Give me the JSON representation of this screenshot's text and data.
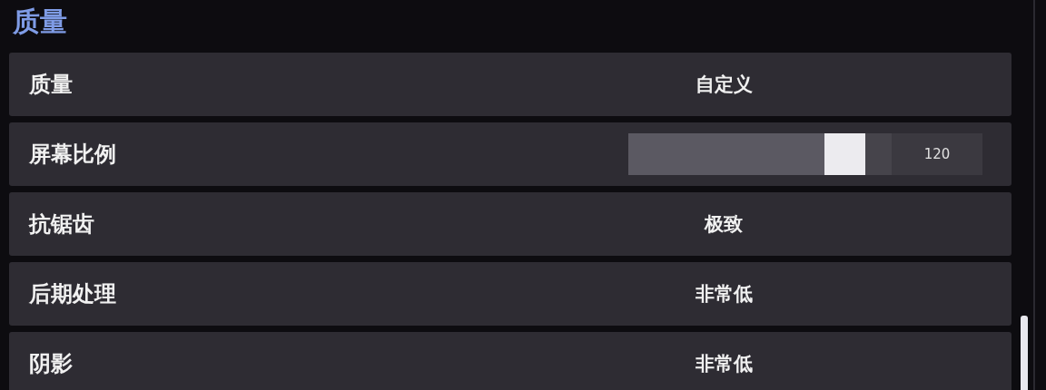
{
  "section_title": "质量",
  "rows": [
    {
      "kind": "option",
      "label": "质量",
      "value": "自定义"
    },
    {
      "kind": "slider",
      "label": "屏幕比例",
      "level": 0.88,
      "reading": "120"
    },
    {
      "kind": "option",
      "label": "抗锯齿",
      "value": "极致"
    },
    {
      "kind": "option",
      "label": "后期处理",
      "value": "非常低"
    },
    {
      "kind": "option",
      "label": "阴影",
      "value": "非常低"
    }
  ]
}
